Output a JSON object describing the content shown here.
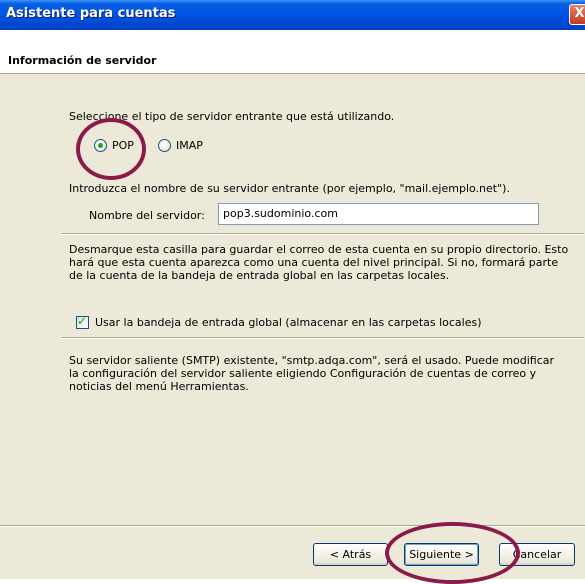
{
  "window": {
    "title": "Asistente para cuentas",
    "close_glyph": "X"
  },
  "header": {
    "title": "Información de servidor"
  },
  "server_type": {
    "prompt": "Seleccione el tipo de servidor entrante que está utilizando.",
    "options": [
      {
        "label": "POP",
        "selected": true
      },
      {
        "label": "IMAP",
        "selected": false
      }
    ]
  },
  "incoming": {
    "prompt": "Introduzca el nombre de su servidor entrante (por ejemplo, \"mail.ejemplo.net\").",
    "field_label": "Nombre del servidor:",
    "field_value": "pop3.sudominio.com"
  },
  "global_inbox": {
    "description": "Desmarque esta casilla para guardar el correo de esta cuenta en su propio directorio. Esto hará que esta cuenta aparezca como una cuenta del nivel principal. Si no, formará parte de la cuenta de la bandeja de entrada global en las carpetas locales.",
    "checkbox_label": "Usar la bandeja de entrada global (almacenar en las carpetas locales)",
    "checked": true
  },
  "smtp_note": "Su servidor saliente (SMTP) existente, \"smtp.adqa.com\", será el usado. Puede modificar la configuración del servidor saliente eligiendo Configuración de cuentas de correo y noticias del menú Herramientas.",
  "buttons": {
    "back": "< Atrás",
    "next": "Siguiente >",
    "cancel": "Cancelar"
  },
  "colors": {
    "annotation": "#8b1a4a",
    "title_bar": "#0055e5"
  }
}
